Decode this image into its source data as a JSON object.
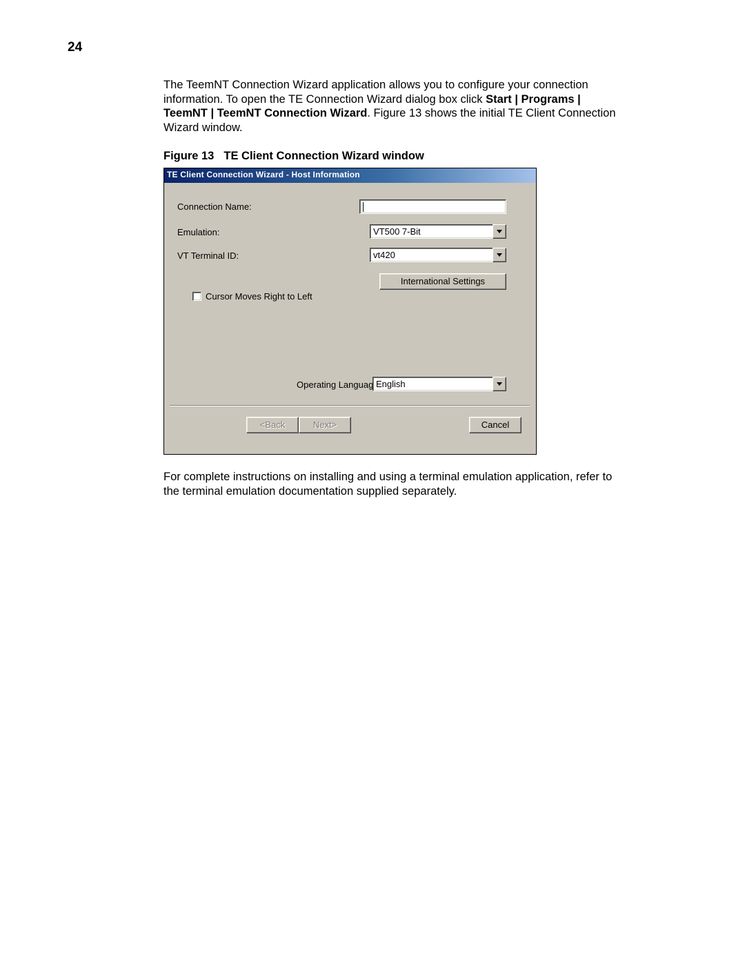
{
  "page_number": "24",
  "intro": {
    "p1a": "The TeemNT Connection Wizard application allows you to configure your connection information. To open the TE Connection Wizard dialog box click ",
    "b1": "Start | Programs | TeemNT | TeemNT Connection Wizard",
    "p1b": ". Figure 13 shows the initial TE Client Connection Wizard window."
  },
  "figure_caption": {
    "label": "Figure 13",
    "title": "TE Client Connection Wizard window"
  },
  "wizard": {
    "title": "TE Client Connection Wizard - Host Information",
    "labels": {
      "connection_name": "Connection Name:",
      "emulation": "Emulation:",
      "vt_terminal_id": "VT Terminal ID:",
      "operating_language": "Operating Language:"
    },
    "fields": {
      "connection_name_value": "",
      "emulation_value": "VT500 7-Bit",
      "vt_terminal_id_value": "vt420",
      "operating_language_value": "English"
    },
    "checkbox": {
      "cursor_rtl_label": "Cursor Moves Right to Left",
      "cursor_rtl_checked": false
    },
    "buttons": {
      "international_settings": "International Settings",
      "back": "<Back",
      "next": "Next>",
      "cancel": "Cancel"
    }
  },
  "outro": "For complete instructions on installing and using a terminal emulation application, refer to the terminal emulation documentation supplied separately."
}
